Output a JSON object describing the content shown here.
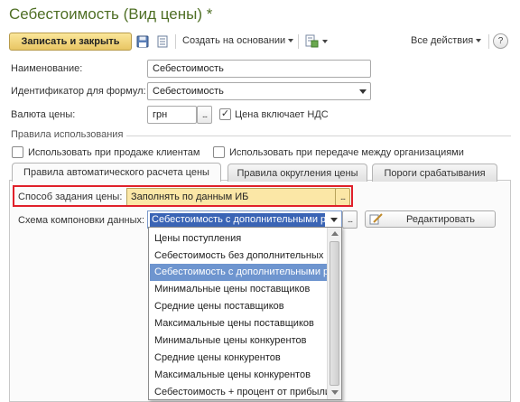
{
  "window": {
    "title": "Себестоимость (Вид цены) *"
  },
  "toolbar": {
    "save_close_label": "Записать и закрыть",
    "create_based_label": "Создать на основании",
    "all_actions_label": "Все действия",
    "help_label": "?"
  },
  "fields": {
    "name_label": "Наименование:",
    "name_value": "Себестоимость",
    "formula_id_label": "Идентификатор для формул:",
    "formula_id_value": "Себестоимость",
    "currency_label": "Валюта цены:",
    "currency_value": "грн",
    "vat_checkbox_label": "Цена включает НДС",
    "vat_checked": true
  },
  "usage_rules": {
    "group_title": "Правила использования",
    "use_selling_label": "Использовать при продаже клиентам",
    "use_transfer_label": "Использовать при передаче между организациями"
  },
  "tabs": [
    {
      "label": "Правила автоматического расчета цены",
      "active": true
    },
    {
      "label": "Правила округления цены",
      "active": false
    },
    {
      "label": "Пороги срабатывания",
      "active": false
    }
  ],
  "auto_calc": {
    "method_label": "Способ задания цены:",
    "method_value": "Заполнять по данным ИБ",
    "scheme_label": "Схема компоновки данных:",
    "scheme_value": "Себестоимость с дополнительными ра",
    "edit_button_label": "Редактировать"
  },
  "scheme_dropdown": {
    "items": [
      "Цены поступления",
      "Себестоимость без дополнительных р...",
      "Себестоимость с дополнительными р...",
      "Минимальные цены поставщиков",
      "Средние цены поставщиков",
      "Максимальные цены поставщиков",
      "Минимальные цены конкурентов",
      "Средние цены конкурентов",
      "Максимальные цены конкурентов",
      "Себестоимость + процент от прибыли ..."
    ],
    "selected_index": 2
  },
  "icons": {
    "save": "save-icon",
    "list": "list-icon",
    "attach": "attachment-icon",
    "edit": "edit-icon"
  },
  "colors": {
    "title": "#4f6f25",
    "primary_button": "#e8c563",
    "highlight_frame": "#e0202a",
    "selected_item": "#6e95cf",
    "combo_selection": "#3a64b5"
  }
}
